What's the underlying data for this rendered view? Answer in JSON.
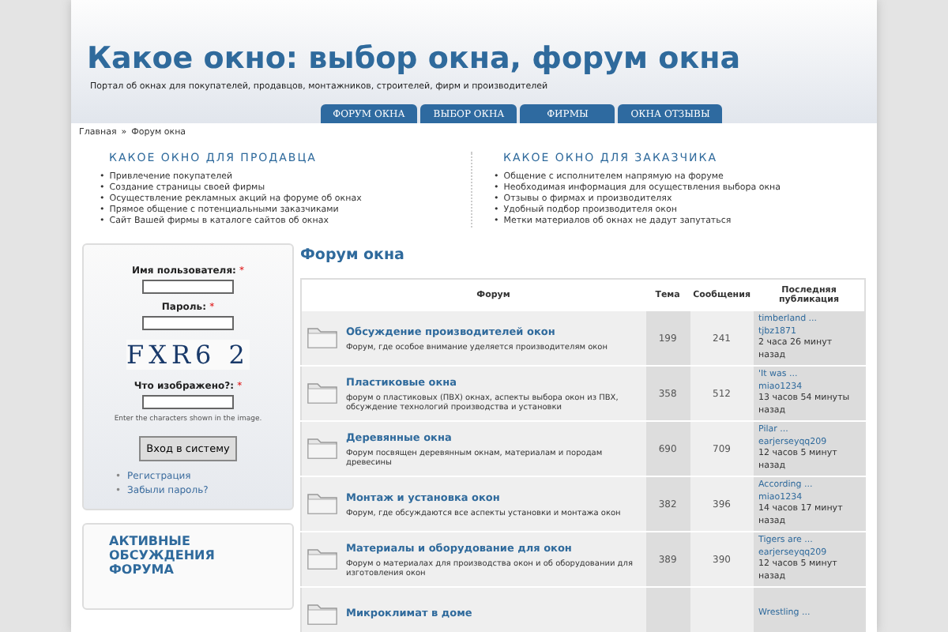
{
  "header": {
    "title": "Какое окно: выбор окна, форум окна",
    "subtitle": "Портал об окнах для покупателей, продавцов, монтажников, строителей, фирм и производителей"
  },
  "list_marker": "•",
  "nav": [
    "ФОРУМ ОКНА",
    "ВЫБОР ОКНА",
    "ФИРМЫ",
    "ОКНА ОТЗЫВЫ"
  ],
  "breadcrumb": {
    "items": [
      "Главная",
      "Форум окна"
    ],
    "separator": "»"
  },
  "info_columns": [
    {
      "heading": "КАКОЕ ОКНО ДЛЯ ПРОДАВЦА",
      "items": [
        "Привлечение покупателей",
        "Создание страницы своей фирмы",
        "Осуществление рекламных акций на форуме об окнах",
        "Прямое общение с потенциальными заказчиками",
        "Сайт Вашей фирмы в каталоге сайтов об окнах"
      ]
    },
    {
      "heading": "КАКОЕ ОКНО ДЛЯ ЗАКАЗЧИКА",
      "items": [
        "Общение с исполнителем напрямую на форуме",
        "Необходимая информация для осуществления выбора окна",
        "Отзывы о фирмах и производителях",
        "Удобный подбор производителя окон",
        "Метки материалов об окнах не дадут запутаться"
      ]
    }
  ],
  "login": {
    "fields": [
      {
        "label": "Имя пользователя:",
        "mark": "*"
      },
      {
        "label": "Пароль:",
        "mark": "*"
      }
    ],
    "captcha": "FXR6 2",
    "captcha_field": {
      "label": "Что изображено?:",
      "mark": "*"
    },
    "hint": "Enter the characters shown in the image.",
    "button": "Вход в систему",
    "links": [
      "Регистрация",
      "Забыли пароль?"
    ]
  },
  "active_block": {
    "title": "АКТИВНЫЕ ОБСУЖДЕНИЯ ФОРУМА"
  },
  "forum": {
    "title": "Форум окна",
    "columns": [
      "Форум",
      "Тема",
      "Сообщения",
      "Последняя публикация"
    ],
    "rows": [
      {
        "name": "Обсуждение производителей окон",
        "description": "Форум, где особое внимание уделяется производителям окон",
        "topics": "199",
        "posts": "241",
        "last_topic": "timberland ...",
        "last_author": "tjbz1871",
        "last_time": "2 часа 26 минут назад"
      },
      {
        "name": "Пластиковые окна",
        "description": "форум о пластиковых (ПВХ) окнах, аспекты выбора окон из ПВХ, обсуждение технологий производства и установки",
        "topics": "358",
        "posts": "512",
        "last_topic": "'It was ...",
        "last_author": "miao1234",
        "last_time": "13 часов 54 минуты назад"
      },
      {
        "name": "Деревянные окна",
        "description": "Форум посвящен деревянным окнам, материалам и породам древесины",
        "topics": "690",
        "posts": "709",
        "last_topic": "Pilar ...",
        "last_author": "earjerseyqq209",
        "last_time": "12 часов 5 минут назад"
      },
      {
        "name": "Монтаж и установка окон",
        "description": "Форум, где обсуждаются все аспекты установки и монтажа окон",
        "topics": "382",
        "posts": "396",
        "last_topic": "According ...",
        "last_author": "miao1234",
        "last_time": "14 часов 17 минут назад"
      },
      {
        "name": "Материалы и оборудование для окон",
        "description": "Форум о материалах для производства окон и об оборудовании для изготовления окон",
        "topics": "389",
        "posts": "390",
        "last_topic": "Tigers are ...",
        "last_author": "earjerseyqq209",
        "last_time": "12 часов 5 минут назад"
      },
      {
        "name": "Микроклимат в доме",
        "last_topic": "Wrestling ..."
      }
    ]
  }
}
